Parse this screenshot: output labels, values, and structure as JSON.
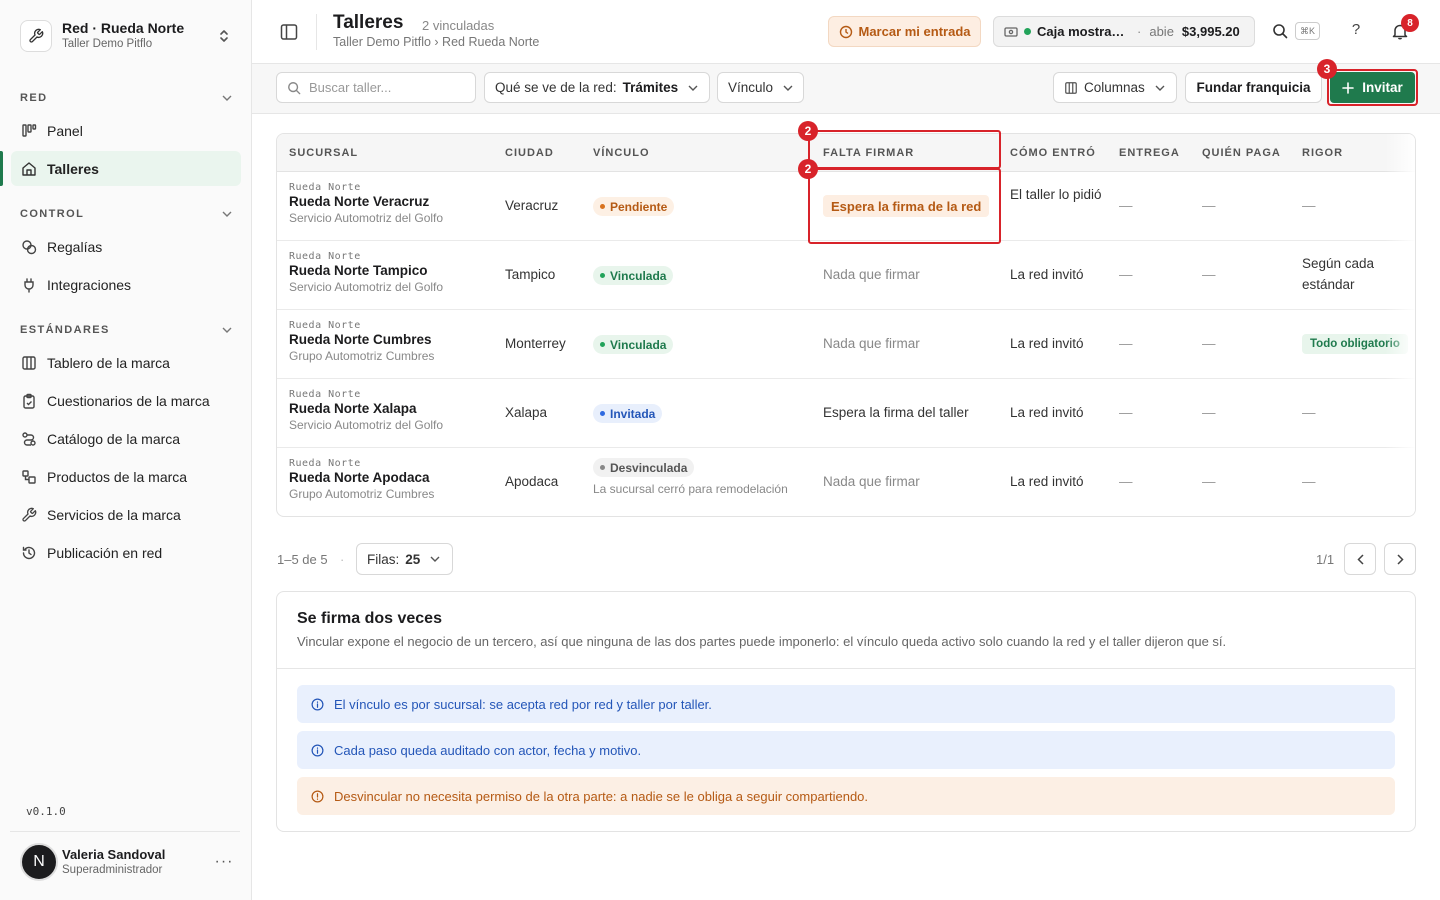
{
  "org": {
    "name": "Red · Rueda Norte",
    "sub": "Taller Demo Pitflo"
  },
  "sidebar": {
    "sections": [
      {
        "label": "RED",
        "items": [
          {
            "label": "Panel",
            "icon": "panel-icon",
            "active": false
          },
          {
            "label": "Talleres",
            "icon": "store-icon",
            "active": true
          }
        ]
      },
      {
        "label": "CONTROL",
        "items": [
          {
            "label": "Regalías",
            "icon": "coins-icon",
            "active": false
          },
          {
            "label": "Integraciones",
            "icon": "plug-icon",
            "active": false
          }
        ]
      },
      {
        "label": "ESTÁNDARES",
        "items": [
          {
            "label": "Tablero de la marca",
            "icon": "columns-icon",
            "active": false
          },
          {
            "label": "Cuestionarios de la marca",
            "icon": "clipboard-icon",
            "active": false
          },
          {
            "label": "Catálogo de la marca",
            "icon": "route-icon",
            "active": false
          },
          {
            "label": "Productos de la marca",
            "icon": "boxes-icon",
            "active": false
          },
          {
            "label": "Servicios de la marca",
            "icon": "wrench-icon",
            "active": false
          },
          {
            "label": "Publicación en red",
            "icon": "history-icon",
            "active": false
          }
        ]
      }
    ],
    "version": "v0.1.0",
    "user": {
      "initial": "N",
      "name": "Valeria Sandoval",
      "role": "Superadministrador"
    }
  },
  "header": {
    "title": "Talleres",
    "count": "2 vinculadas",
    "breadcrumb": "Taller Demo Pitflo › Red Rueda Norte",
    "entrada_label": "Marcar mi entrada",
    "caja": {
      "name": "Caja mostrad...",
      "sep": "·",
      "status": "abie",
      "amount": "$3,995.20"
    },
    "kbd": "⌘K",
    "help": "?",
    "notifications": "8"
  },
  "toolbar": {
    "search_placeholder": "Buscar taller...",
    "visibility_label": "Qué se ve de la red:",
    "visibility_value": "Trámites",
    "vinculo_label": "Vínculo",
    "columns_label": "Columnas",
    "fundar_label": "Fundar franquicia",
    "invite_label": "Invitar"
  },
  "markers": {
    "col": "2",
    "cell": "2",
    "invite": "3"
  },
  "table": {
    "headers": [
      "SUCURSAL",
      "CIUDAD",
      "VÍNCULO",
      "FALTA FIRMAR",
      "CÓMO ENTRÓ",
      "ENTREGA",
      "QUIÉN PAGA",
      "RIGOR"
    ],
    "rows": [
      {
        "net": "Rueda Norte",
        "name": "Rueda Norte Veracruz",
        "group": "Servicio Automotriz del Golfo",
        "city": "Veracruz",
        "status": "Pendiente",
        "status_kind": "pend",
        "status_note": "",
        "falta": "Espera la firma de la red",
        "falta_kind": "badge",
        "entro": "El taller lo pidió",
        "entrega": "—",
        "paga": "—",
        "rigor": "—",
        "rigor_kind": "dash"
      },
      {
        "net": "Rueda Norte",
        "name": "Rueda Norte Tampico",
        "group": "Servicio Automotriz del Golfo",
        "city": "Tampico",
        "status": "Vinculada",
        "status_kind": "vinc",
        "status_note": "",
        "falta": "Nada que firmar",
        "falta_kind": "muted",
        "entro": "La red invitó",
        "entrega": "—",
        "paga": "—",
        "rigor": "Según cada estándar",
        "rigor_kind": "text"
      },
      {
        "net": "Rueda Norte",
        "name": "Rueda Norte Cumbres",
        "group": "Grupo Automotriz Cumbres",
        "city": "Monterrey",
        "status": "Vinculada",
        "status_kind": "vinc",
        "status_note": "",
        "falta": "Nada que firmar",
        "falta_kind": "muted",
        "entro": "La red invitó",
        "entrega": "—",
        "paga": "—",
        "rigor": "Todo obligatorio",
        "rigor_kind": "badge"
      },
      {
        "net": "Rueda Norte",
        "name": "Rueda Norte Xalapa",
        "group": "Servicio Automotriz del Golfo",
        "city": "Xalapa",
        "status": "Invitada",
        "status_kind": "inv",
        "status_note": "",
        "falta": "Espera la firma del taller",
        "falta_kind": "text",
        "entro": "La red invitó",
        "entrega": "—",
        "paga": "—",
        "rigor": "—",
        "rigor_kind": "dash"
      },
      {
        "net": "Rueda Norte",
        "name": "Rueda Norte Apodaca",
        "group": "Grupo Automotriz Cumbres",
        "city": "Apodaca",
        "status": "Desvinculada",
        "status_kind": "desv",
        "status_note": "La sucursal cerró para remodelación",
        "falta": "Nada que firmar",
        "falta_kind": "muted",
        "entro": "La red invitó",
        "entrega": "—",
        "paga": "—",
        "rigor": "—",
        "rigor_kind": "dash"
      }
    ]
  },
  "pagination": {
    "info": "1–5 de 5",
    "dot": "·",
    "rows_label": "Filas:",
    "rows_value": "25",
    "page": "1/1"
  },
  "card": {
    "title": "Se firma dos veces",
    "desc": "Vincular expone el negocio de un tercero, así que ninguna de las dos partes puede imponerlo: el vínculo queda activo solo cuando la red y el taller dijeron que sí.",
    "notes": [
      {
        "text": "El vínculo es por sucursal: se acepta red por red y taller por taller.",
        "kind": "blue"
      },
      {
        "text": "Cada paso queda auditado con actor, fecha y motivo.",
        "kind": "blue"
      },
      {
        "text": "Desvincular no necesita permiso de la otra parte: a nadie se le obliga a seguir compartiendo.",
        "kind": "orange"
      }
    ]
  },
  "colors": {
    "accent": "#1f7a4d",
    "danger": "#d8232a",
    "warning": "#b55a14",
    "info": "#2456b8"
  }
}
